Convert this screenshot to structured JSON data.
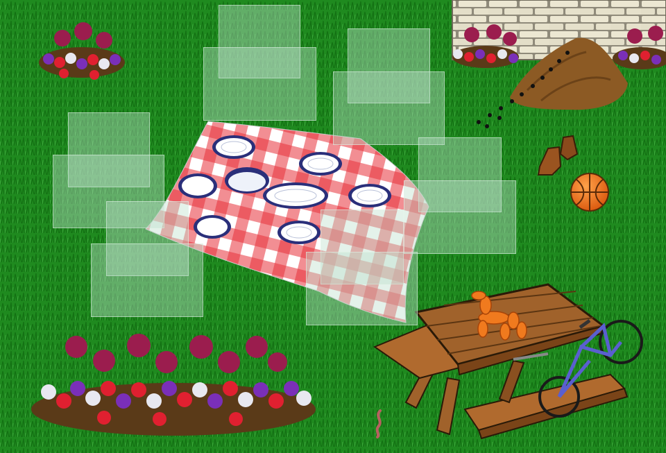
{
  "scene": {
    "colors": {
      "grass": "#1f8a1f",
      "grass_dark": "#137013",
      "cloth_red": "#e8323a",
      "cloth_white": "#ffffff",
      "plate_rim": "#2a2f7a",
      "wood": "#a0622b",
      "wood_dark": "#5b3512",
      "balloon": "#f07a1e",
      "basketball": "#f0731c",
      "bike": "#5a5fd0",
      "wall": "#e9e4cf",
      "dirt": "#8c5a24",
      "slot_fill": "#cfe9d8"
    },
    "objects": [
      "picnic-blanket",
      "plate",
      "picnic-table",
      "balloon-dog",
      "bicycle",
      "basketball",
      "boots",
      "ant-hill",
      "ants",
      "stone-wall",
      "flower-bed",
      "earthworm"
    ],
    "hidden_slot_count": 12
  }
}
